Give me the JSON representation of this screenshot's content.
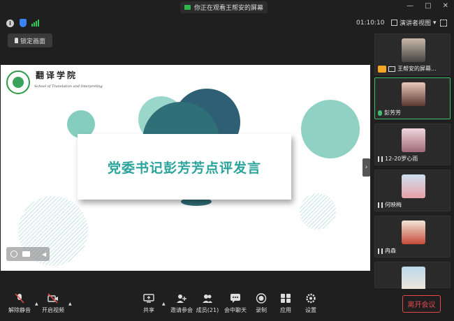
{
  "titlebar": {
    "share_notice": "你正在观看王帮安的屏幕",
    "minimize": "—",
    "maximize": "□",
    "close": "✕"
  },
  "status": {
    "timer": "01:10:10",
    "view_mode": "演讲者视图",
    "view_caret": "▾"
  },
  "lock_button": "锁定画面",
  "slide": {
    "school_cn": "翻译学院",
    "school_en": "School of Translation and Interpreting",
    "headline": "党委书记彭芳芳点评发言"
  },
  "participants": [
    {
      "name": "王帮安的屏幕...",
      "mic": "none",
      "colors": [
        "#c9b8a8",
        "#444"
      ]
    },
    {
      "name": "彭芳芳",
      "mic": "on",
      "colors": [
        "#e8c8b8",
        "#5a3a30"
      ]
    },
    {
      "name": "12-20罗心雨",
      "mic": "off",
      "colors": [
        "#f1d6de",
        "#a06a78"
      ]
    },
    {
      "name": "何映梅",
      "mic": "off",
      "colors": [
        "#cfe0f0",
        "#e8a0a8"
      ]
    },
    {
      "name": "冉森",
      "mic": "off",
      "colors": [
        "#f2e6d8",
        "#c84a3a"
      ]
    },
    {
      "name": "",
      "mic": "none",
      "colors": [
        "#bcd8ec",
        "#f0e6da"
      ]
    }
  ],
  "toolbar": {
    "unmute": "解除静音",
    "start_video": "开启视频",
    "share": "共享",
    "invite": "邀请参会",
    "members": "成员(21)",
    "chat": "会中聊天",
    "record": "录制",
    "apps": "应用",
    "settings": "设置",
    "leave": "离开会议"
  },
  "colors": {
    "accent_green": "#3fbf6f",
    "leave_red": "#e5484d",
    "slide_teal": "#2aa39a"
  }
}
